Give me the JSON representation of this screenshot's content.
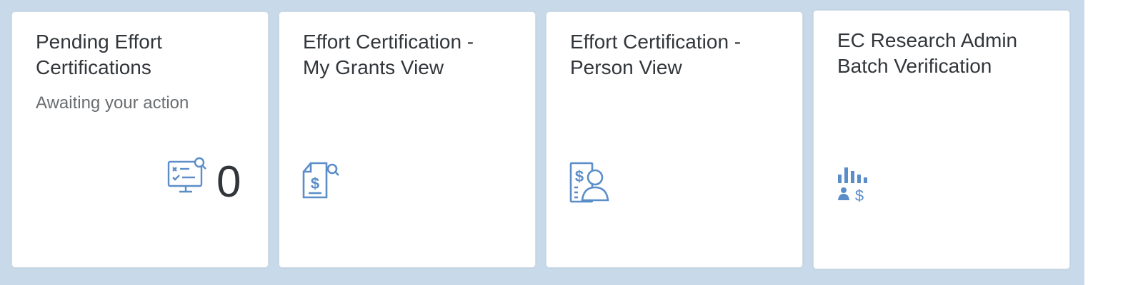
{
  "tiles": [
    {
      "title": "Pending Effort\nCertifications",
      "subtitle": "Awaiting your action",
      "value": "0",
      "icon": "certification-checklist-icon"
    },
    {
      "title": "Effort Certification -\nMy Grants View",
      "icon": "document-dollar-search-icon"
    },
    {
      "title": "Effort Certification -\nPerson View",
      "icon": "document-dollar-person-icon"
    },
    {
      "title": "EC Research Admin\nBatch Verification",
      "icon": "bar-chart-person-dollar-icon"
    }
  ],
  "colors": {
    "background": "#c8daea",
    "tile": "#ffffff",
    "icon": "#5b8dc8",
    "text": "#32363a",
    "subtext": "#6a6d70"
  }
}
